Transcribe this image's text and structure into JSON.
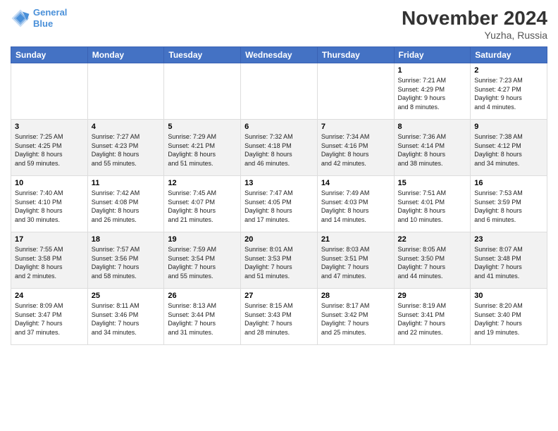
{
  "header": {
    "logo_line1": "General",
    "logo_line2": "Blue",
    "month_year": "November 2024",
    "location": "Yuzha, Russia"
  },
  "days_of_week": [
    "Sunday",
    "Monday",
    "Tuesday",
    "Wednesday",
    "Thursday",
    "Friday",
    "Saturday"
  ],
  "weeks": [
    [
      {
        "day": "",
        "info": ""
      },
      {
        "day": "",
        "info": ""
      },
      {
        "day": "",
        "info": ""
      },
      {
        "day": "",
        "info": ""
      },
      {
        "day": "",
        "info": ""
      },
      {
        "day": "1",
        "info": "Sunrise: 7:21 AM\nSunset: 4:29 PM\nDaylight: 9 hours\nand 8 minutes."
      },
      {
        "day": "2",
        "info": "Sunrise: 7:23 AM\nSunset: 4:27 PM\nDaylight: 9 hours\nand 4 minutes."
      }
    ],
    [
      {
        "day": "3",
        "info": "Sunrise: 7:25 AM\nSunset: 4:25 PM\nDaylight: 8 hours\nand 59 minutes."
      },
      {
        "day": "4",
        "info": "Sunrise: 7:27 AM\nSunset: 4:23 PM\nDaylight: 8 hours\nand 55 minutes."
      },
      {
        "day": "5",
        "info": "Sunrise: 7:29 AM\nSunset: 4:21 PM\nDaylight: 8 hours\nand 51 minutes."
      },
      {
        "day": "6",
        "info": "Sunrise: 7:32 AM\nSunset: 4:18 PM\nDaylight: 8 hours\nand 46 minutes."
      },
      {
        "day": "7",
        "info": "Sunrise: 7:34 AM\nSunset: 4:16 PM\nDaylight: 8 hours\nand 42 minutes."
      },
      {
        "day": "8",
        "info": "Sunrise: 7:36 AM\nSunset: 4:14 PM\nDaylight: 8 hours\nand 38 minutes."
      },
      {
        "day": "9",
        "info": "Sunrise: 7:38 AM\nSunset: 4:12 PM\nDaylight: 8 hours\nand 34 minutes."
      }
    ],
    [
      {
        "day": "10",
        "info": "Sunrise: 7:40 AM\nSunset: 4:10 PM\nDaylight: 8 hours\nand 30 minutes."
      },
      {
        "day": "11",
        "info": "Sunrise: 7:42 AM\nSunset: 4:08 PM\nDaylight: 8 hours\nand 26 minutes."
      },
      {
        "day": "12",
        "info": "Sunrise: 7:45 AM\nSunset: 4:07 PM\nDaylight: 8 hours\nand 21 minutes."
      },
      {
        "day": "13",
        "info": "Sunrise: 7:47 AM\nSunset: 4:05 PM\nDaylight: 8 hours\nand 17 minutes."
      },
      {
        "day": "14",
        "info": "Sunrise: 7:49 AM\nSunset: 4:03 PM\nDaylight: 8 hours\nand 14 minutes."
      },
      {
        "day": "15",
        "info": "Sunrise: 7:51 AM\nSunset: 4:01 PM\nDaylight: 8 hours\nand 10 minutes."
      },
      {
        "day": "16",
        "info": "Sunrise: 7:53 AM\nSunset: 3:59 PM\nDaylight: 8 hours\nand 6 minutes."
      }
    ],
    [
      {
        "day": "17",
        "info": "Sunrise: 7:55 AM\nSunset: 3:58 PM\nDaylight: 8 hours\nand 2 minutes."
      },
      {
        "day": "18",
        "info": "Sunrise: 7:57 AM\nSunset: 3:56 PM\nDaylight: 7 hours\nand 58 minutes."
      },
      {
        "day": "19",
        "info": "Sunrise: 7:59 AM\nSunset: 3:54 PM\nDaylight: 7 hours\nand 55 minutes."
      },
      {
        "day": "20",
        "info": "Sunrise: 8:01 AM\nSunset: 3:53 PM\nDaylight: 7 hours\nand 51 minutes."
      },
      {
        "day": "21",
        "info": "Sunrise: 8:03 AM\nSunset: 3:51 PM\nDaylight: 7 hours\nand 47 minutes."
      },
      {
        "day": "22",
        "info": "Sunrise: 8:05 AM\nSunset: 3:50 PM\nDaylight: 7 hours\nand 44 minutes."
      },
      {
        "day": "23",
        "info": "Sunrise: 8:07 AM\nSunset: 3:48 PM\nDaylight: 7 hours\nand 41 minutes."
      }
    ],
    [
      {
        "day": "24",
        "info": "Sunrise: 8:09 AM\nSunset: 3:47 PM\nDaylight: 7 hours\nand 37 minutes."
      },
      {
        "day": "25",
        "info": "Sunrise: 8:11 AM\nSunset: 3:46 PM\nDaylight: 7 hours\nand 34 minutes."
      },
      {
        "day": "26",
        "info": "Sunrise: 8:13 AM\nSunset: 3:44 PM\nDaylight: 7 hours\nand 31 minutes."
      },
      {
        "day": "27",
        "info": "Sunrise: 8:15 AM\nSunset: 3:43 PM\nDaylight: 7 hours\nand 28 minutes."
      },
      {
        "day": "28",
        "info": "Sunrise: 8:17 AM\nSunset: 3:42 PM\nDaylight: 7 hours\nand 25 minutes."
      },
      {
        "day": "29",
        "info": "Sunrise: 8:19 AM\nSunset: 3:41 PM\nDaylight: 7 hours\nand 22 minutes."
      },
      {
        "day": "30",
        "info": "Sunrise: 8:20 AM\nSunset: 3:40 PM\nDaylight: 7 hours\nand 19 minutes."
      }
    ]
  ]
}
